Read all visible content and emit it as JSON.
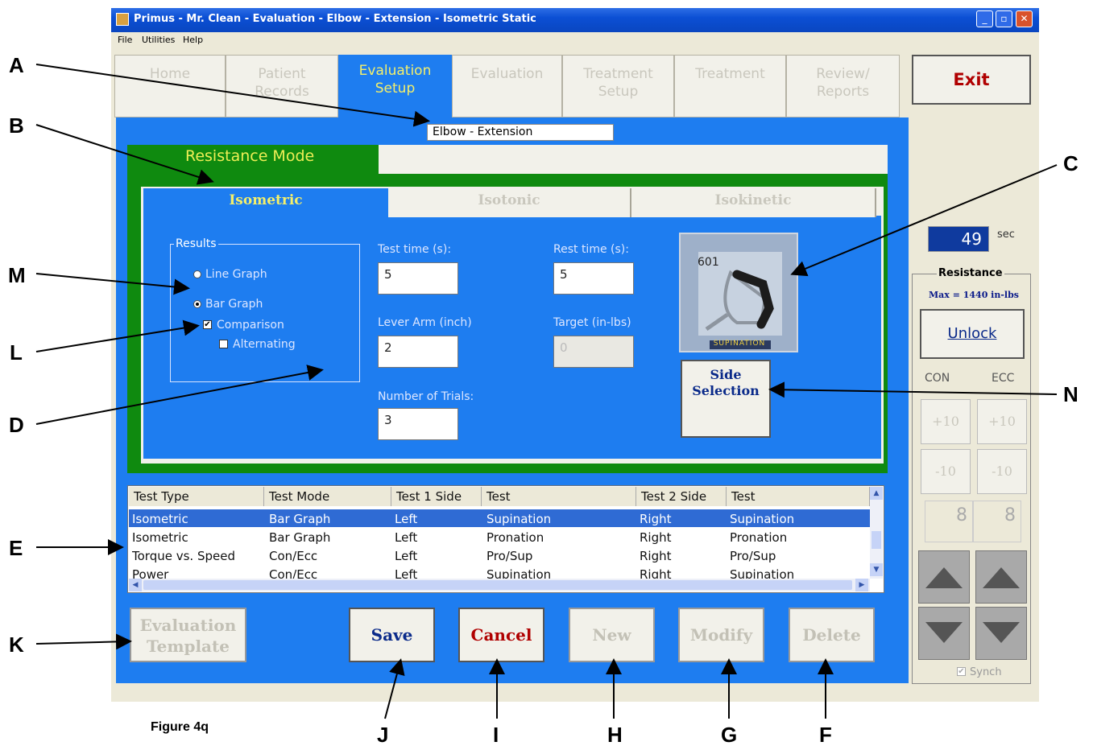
{
  "window": {
    "title": "Primus - Mr. Clean - Evaluation - Elbow - Extension - Isometric Static"
  },
  "menu": [
    "File",
    "Utilities",
    "Help"
  ],
  "top_tabs": {
    "home": "Home",
    "patient_records_1": "Patient",
    "patient_records_2": "Records",
    "eval_setup_1": "Evaluation",
    "eval_setup_2": "Setup",
    "evaluation": "Evaluation",
    "treatment_setup_1": "Treatment",
    "treatment_setup_2": "Setup",
    "treatment": "Treatment",
    "review_1": "Review/",
    "review_2": "Reports"
  },
  "exit_label": "Exit",
  "body_part": "Elbow - Extension",
  "resistance_mode_label": "Resistance Mode",
  "mode_tabs": {
    "isometric": "Isometric",
    "isotonic": "Isotonic",
    "isokinetic": "Isokinetic"
  },
  "results": {
    "legend": "Results",
    "line_graph": "Line Graph",
    "bar_graph": "Bar Graph",
    "selected": "bar_graph",
    "comparison": "Comparison",
    "comparison_checked": true,
    "alternating": "Alternating",
    "alternating_checked": false
  },
  "fields": {
    "test_time_label": "Test time (s):",
    "test_time": "5",
    "rest_time_label": "Rest time (s):",
    "rest_time": "5",
    "lever_arm_label": "Lever Arm (inch)",
    "lever_arm": "2",
    "target_label": "Target (in-lbs)",
    "target": "0",
    "trials_label": "Number of Trials:",
    "trials": "3"
  },
  "device": {
    "number": "601",
    "caption": "SUPINATION"
  },
  "side_selection": {
    "line1": "Side",
    "line2": "Selection"
  },
  "table": {
    "headers": [
      "Test Type",
      "Test Mode",
      "Test 1 Side",
      "Test",
      "Test 2 Side",
      "Test"
    ],
    "rows": [
      [
        "Isometric",
        "Bar Graph",
        "Left",
        "Supination",
        "Right",
        "Supination"
      ],
      [
        "Isometric",
        "Bar Graph",
        "Left",
        "Pronation",
        "Right",
        "Pronation"
      ],
      [
        "Torque vs. Speed",
        "Con/Ecc",
        "Left",
        "Pro/Sup",
        "Right",
        "Pro/Sup"
      ],
      [
        "Power",
        "Con/Ecc",
        "Left",
        "Supination",
        "Right",
        "Supination"
      ]
    ],
    "selected_row": 0
  },
  "buttons": {
    "eval_template_1": "Evaluation",
    "eval_template_2": "Template",
    "save": "Save",
    "cancel": "Cancel",
    "new": "New",
    "modify": "Modify",
    "delete": "Delete"
  },
  "right_panel": {
    "timer": "49",
    "timer_unit": "sec",
    "resistance_legend": "Resistance",
    "max": "Max = 1440 in-lbs",
    "unlock": "Unlock",
    "con": "CON",
    "ecc": "ECC",
    "plus10_con": "+10",
    "plus10_ecc": "+10",
    "minus10_con": "-10",
    "minus10_ecc": "-10",
    "value_con": "8",
    "value_ecc": "8",
    "synch": "Synch"
  },
  "annotations": [
    "A",
    "B",
    "C",
    "M",
    "L",
    "D",
    "N",
    "E",
    "K",
    "J",
    "I",
    "H",
    "G",
    "F"
  ],
  "figure_caption": "Figure 4q",
  "colors": {
    "panel_blue": "#1e7df0",
    "green": "#0f8a0f",
    "tab_active_text": "#f4ef6a",
    "exit_red": "#b00000"
  }
}
